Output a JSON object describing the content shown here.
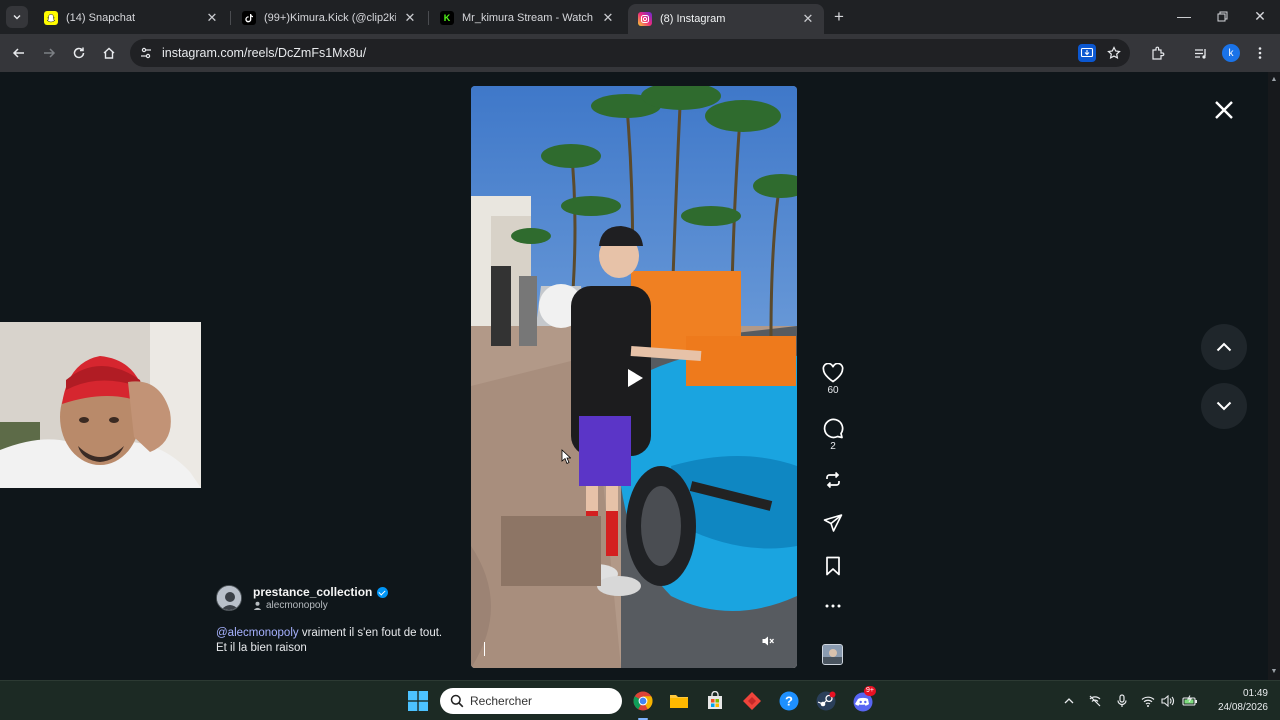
{
  "browser": {
    "tabs": [
      {
        "title": "(14) Snapchat",
        "icon": "snapchat-icon",
        "active": false
      },
      {
        "title": "(99+)Kimura.Kick (@clip2kimura",
        "icon": "tiktok-icon",
        "active": false
      },
      {
        "title": "Mr_kimura Stream - Watch Live",
        "icon": "kick-icon",
        "active": false
      },
      {
        "title": "(8) Instagram",
        "icon": "instagram-icon",
        "active": true
      }
    ],
    "url": "instagram.com/reels/DcZmFs1Mx8u/",
    "profile_initial": "k"
  },
  "reel": {
    "likes": "60",
    "comments": "2",
    "author": {
      "username": "prestance_collection",
      "verified": true,
      "collaborator": "alecmonopoly"
    },
    "caption": {
      "mention": "@alecmonopoly",
      "text": " vraiment il s'en fout de tout. Et il la bien raison"
    }
  },
  "taskbar": {
    "search_placeholder": "Rechercher",
    "time": "01:49",
    "date": "24/08/2026",
    "discord_badge": "9+"
  },
  "colors": {
    "page_bg": "#0f161a",
    "chrome_bg": "#35363a",
    "accent_blue": "#0095f6",
    "mention": "#a7b2ff",
    "taskbar_bg": "#1c2a24"
  }
}
